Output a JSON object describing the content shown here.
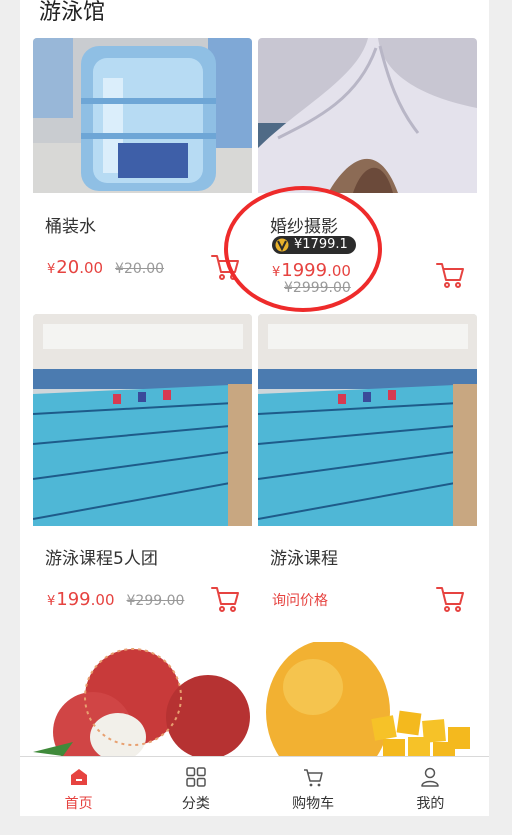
{
  "section": {
    "title": "游泳馆"
  },
  "products": [
    {
      "name": "桶装水",
      "currency": "¥",
      "price_int": "20",
      "price_dec": ".00",
      "original": "¥20.00"
    },
    {
      "name": "婚纱摄影",
      "vip_price": "¥1799.1",
      "currency": "¥",
      "price_int": "1999",
      "price_dec": ".00",
      "original": "¥2999.00"
    },
    {
      "name": "游泳课程5人团",
      "currency": "¥",
      "price_int": "199",
      "price_dec": ".00",
      "original": "¥299.00"
    },
    {
      "name": "游泳课程",
      "ask_price": "询问价格"
    }
  ],
  "tabbar": {
    "items": [
      {
        "label": "首页",
        "icon": "home-icon",
        "active": true
      },
      {
        "label": "分类",
        "icon": "category-grid-icon"
      },
      {
        "label": "购物车",
        "icon": "cart-icon"
      },
      {
        "label": "我的",
        "icon": "user-icon"
      }
    ]
  },
  "colors": {
    "accent": "#e64340",
    "annotation_circle": "#ee2b2b"
  }
}
